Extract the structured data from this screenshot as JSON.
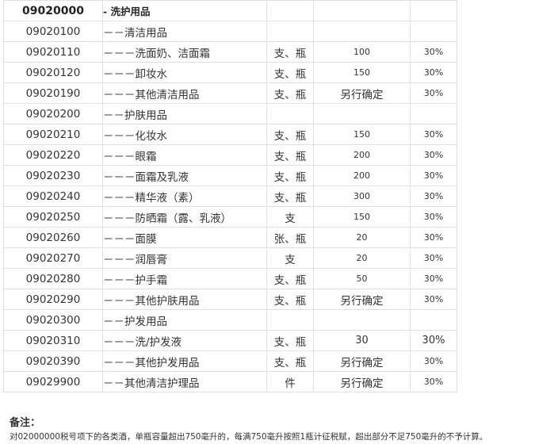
{
  "rows": [
    {
      "code": "09020000",
      "name": "- 洗护用品",
      "unit": "",
      "qty": "",
      "rate": ""
    },
    {
      "code": "09020100",
      "name": "－－清洁用品",
      "unit": "",
      "qty": "",
      "rate": ""
    },
    {
      "code": "09020110",
      "name": "－－－洗面奶、洁面霜",
      "unit": "支、瓶",
      "qty": "100",
      "rate": "30%"
    },
    {
      "code": "09020120",
      "name": "－－－卸妆水",
      "unit": "支、瓶",
      "qty": "150",
      "rate": "30%"
    },
    {
      "code": "09020190",
      "name": "－－－其他清洁用品",
      "unit": "支、瓶",
      "qty": "另行确定",
      "rate": "30%"
    },
    {
      "code": "09020200",
      "name": "－－护肤用品",
      "unit": "",
      "qty": "",
      "rate": ""
    },
    {
      "code": "09020210",
      "name": "－－－化妆水",
      "unit": "支、瓶",
      "qty": "150",
      "rate": "30%"
    },
    {
      "code": "09020220",
      "name": "－－－眼霜",
      "unit": "支、瓶",
      "qty": "200",
      "rate": "30%"
    },
    {
      "code": "09020230",
      "name": "－－－面霜及乳液",
      "unit": "支、瓶",
      "qty": "200",
      "rate": "30%"
    },
    {
      "code": "09020240",
      "name": "－－－精华液（素）",
      "unit": "支、瓶",
      "qty": "300",
      "rate": "30%"
    },
    {
      "code": "09020250",
      "name": "－－－防晒霜（露、乳液）",
      "unit": "支",
      "qty": "150",
      "rate": "30%"
    },
    {
      "code": "09020260",
      "name": "－－－面膜",
      "unit": "张、瓶",
      "qty": "20",
      "rate": "30%"
    },
    {
      "code": "09020270",
      "name": "－－－润唇膏",
      "unit": "支",
      "qty": "20",
      "rate": "30%"
    },
    {
      "code": "09020280",
      "name": "－－－护手霜",
      "unit": "支、瓶",
      "qty": "50",
      "rate": "30%"
    },
    {
      "code": "09020290",
      "name": "－－－其他护肤用品",
      "unit": "支、瓶",
      "qty": "另行确定",
      "rate": "30%"
    },
    {
      "code": "09020300",
      "name": "－－护发用品",
      "unit": "",
      "qty": "",
      "rate": ""
    },
    {
      "code": "09020310",
      "name": "－－－洗/护发液",
      "unit": "支、瓶",
      "qty": "30",
      "rate": "30%"
    },
    {
      "code": "09020390",
      "name": "－－－其他护发用品",
      "unit": "支、瓶",
      "qty": "另行确定",
      "rate": "30%"
    },
    {
      "code": "09029900",
      "name": "－－其他清洁护理品",
      "unit": "件",
      "qty": "另行确定",
      "rate": "30%"
    }
  ],
  "note": {
    "title": "备注：",
    "text": "对02000000税号项下的各类酒，单瓶容量超出750毫升的，每满750毫升按照1瓶计征税赋，超出部分不足750毫升的不予计算。"
  }
}
